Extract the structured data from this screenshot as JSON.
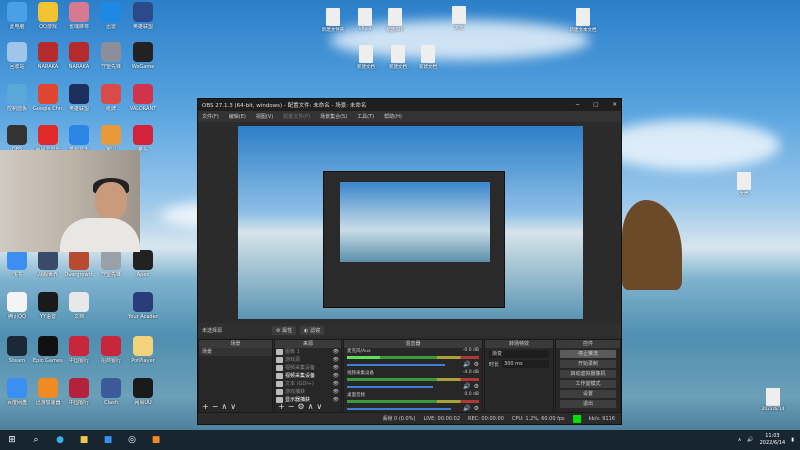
{
  "desktop": {
    "icons": [
      {
        "label": "此电脑",
        "color": "#4aa0e6"
      },
      {
        "label": "QQ游戏",
        "color": "#f2c230"
      },
      {
        "label": "雀魂麻将",
        "color": "#d77a8f"
      },
      {
        "label": "迅雷",
        "color": "#1e88e5"
      },
      {
        "label": "英雄联盟",
        "color": "#2c4a8a"
      },
      {
        "label": "回收站",
        "color": "#9fc6e8"
      },
      {
        "label": "NARAKA",
        "color": "#b52a2a"
      },
      {
        "label": "NARAKA",
        "color": "#b52a2a"
      },
      {
        "label": "守望先锋",
        "color": "#8a8f99"
      },
      {
        "label": "WeGame",
        "color": "#222222"
      },
      {
        "label": "控制面板",
        "color": "#5aa8d8"
      },
      {
        "label": "Google Chrome",
        "color": "#e0452f"
      },
      {
        "label": "英雄联盟",
        "color": "#1d2f5c"
      },
      {
        "label": "纸牌",
        "color": "#d94a4a"
      },
      {
        "label": "VALORANT",
        "color": "#d0344a"
      },
      {
        "label": "OBS",
        "color": "#333333"
      },
      {
        "label": "网易云音乐",
        "color": "#e02a2a"
      },
      {
        "label": "酷狗音乐",
        "color": "#2c86e8"
      },
      {
        "label": "家园",
        "color": "#e89a3a"
      },
      {
        "label": "拳头",
        "color": "#d2233a"
      },
      {
        "label": "飞书",
        "color": "#3c8ef0"
      },
      {
        "label": "战舰世界",
        "color": "#3a4a6a"
      },
      {
        "label": "Overgrowth",
        "color": "#b84a30"
      },
      {
        "label": "守望先锋",
        "color": "#9aa0a8"
      },
      {
        "label": "Apex",
        "color": "#222222"
      },
      {
        "label": "腾讯QQ",
        "color": "#f4f4f4"
      },
      {
        "label": "YY语音",
        "color": "#1a1a1a"
      },
      {
        "label": "文档",
        "color": "#e8e8e8"
      },
      {
        "label": "",
        "color": "transparent"
      },
      {
        "label": "Your Academy",
        "color": "#2a3c7a"
      },
      {
        "label": "Steam",
        "color": "#1b2838"
      },
      {
        "label": "Epic Games Launcher",
        "color": "#111111"
      },
      {
        "label": "中国银行",
        "color": "#c8263a"
      },
      {
        "label": "招商银行",
        "color": "#c8263a"
      },
      {
        "label": "PotPlayer",
        "color": "#f2d27a"
      },
      {
        "label": "百度网盘",
        "color": "#3b8ff0"
      },
      {
        "label": "迅游加速器",
        "color": "#f08a24"
      },
      {
        "label": "中国银行",
        "color": "#b3213a"
      },
      {
        "label": "Clash",
        "color": "#3a5a9a"
      },
      {
        "label": "网易UU",
        "color": "#1a1a1a"
      }
    ],
    "top_files": [
      {
        "label": "新建文件夹"
      },
      {
        "label": "VRoid"
      },
      {
        "label": "新建RTF"
      },
      {
        "label": "游戏"
      },
      {
        "label": "新建文本文档"
      }
    ],
    "mid_files": [
      {
        "label": "新建文档"
      },
      {
        "label": "新建文档"
      },
      {
        "label": "新建文档"
      }
    ],
    "right_files": [
      {
        "label": "文档"
      },
      {
        "label": "2022/6/14"
      }
    ]
  },
  "obs": {
    "title": "OBS 27.1.3 (64-bit, windows) - 配置文件: 未命名 - 场景: 未命名",
    "menu": [
      "文件(F)",
      "编辑(E)",
      "视图(V)",
      "配置文件(P)",
      "场景集合(S)",
      "工具(T)",
      "帮助(H)"
    ],
    "no_source": "未选择源",
    "properties": "属性",
    "filters": "滤镜",
    "docks": {
      "scenes": {
        "title": "场景",
        "items": [
          "场景"
        ]
      },
      "sources": {
        "title": "来源",
        "items": [
          "图像 1",
          "游戏源",
          "视频采集设备",
          "视频采集设备",
          "文本 (GDI+)",
          "游戏捕获",
          "显示器捕获"
        ]
      },
      "mixer": {
        "title": "混音器",
        "channels": [
          {
            "name": "麦克风/Aux",
            "db": "-0.0 dB",
            "level": 0.25,
            "volume": 0.95
          },
          {
            "name": "视频采集设备",
            "db": "-4.0 dB",
            "level": 0,
            "volume": 0.83
          },
          {
            "name": "桌面音频",
            "db": "0.0 dB",
            "level": 0,
            "volume": 1
          }
        ]
      },
      "transitions": {
        "title": "转场特效",
        "type": "渐变",
        "duration_label": "时长",
        "duration": "300 ms"
      },
      "controls": {
        "title": "控件",
        "buttons": [
          "停止推流",
          "开始录制",
          "启动虚拟摄像机",
          "工作室模式",
          "设置",
          "退出"
        ]
      }
    },
    "status": {
      "dropped": "丢帧 0 (0.0%)",
      "live": "LIVE: 00:00:02",
      "rec": "REC: 00:00:00",
      "cpu": "CPU: 1.2%, 60.00 fps",
      "kbps": "kb/s: 9116"
    }
  },
  "taskbar": {
    "time": "11:03",
    "date": "2022/6/14"
  }
}
